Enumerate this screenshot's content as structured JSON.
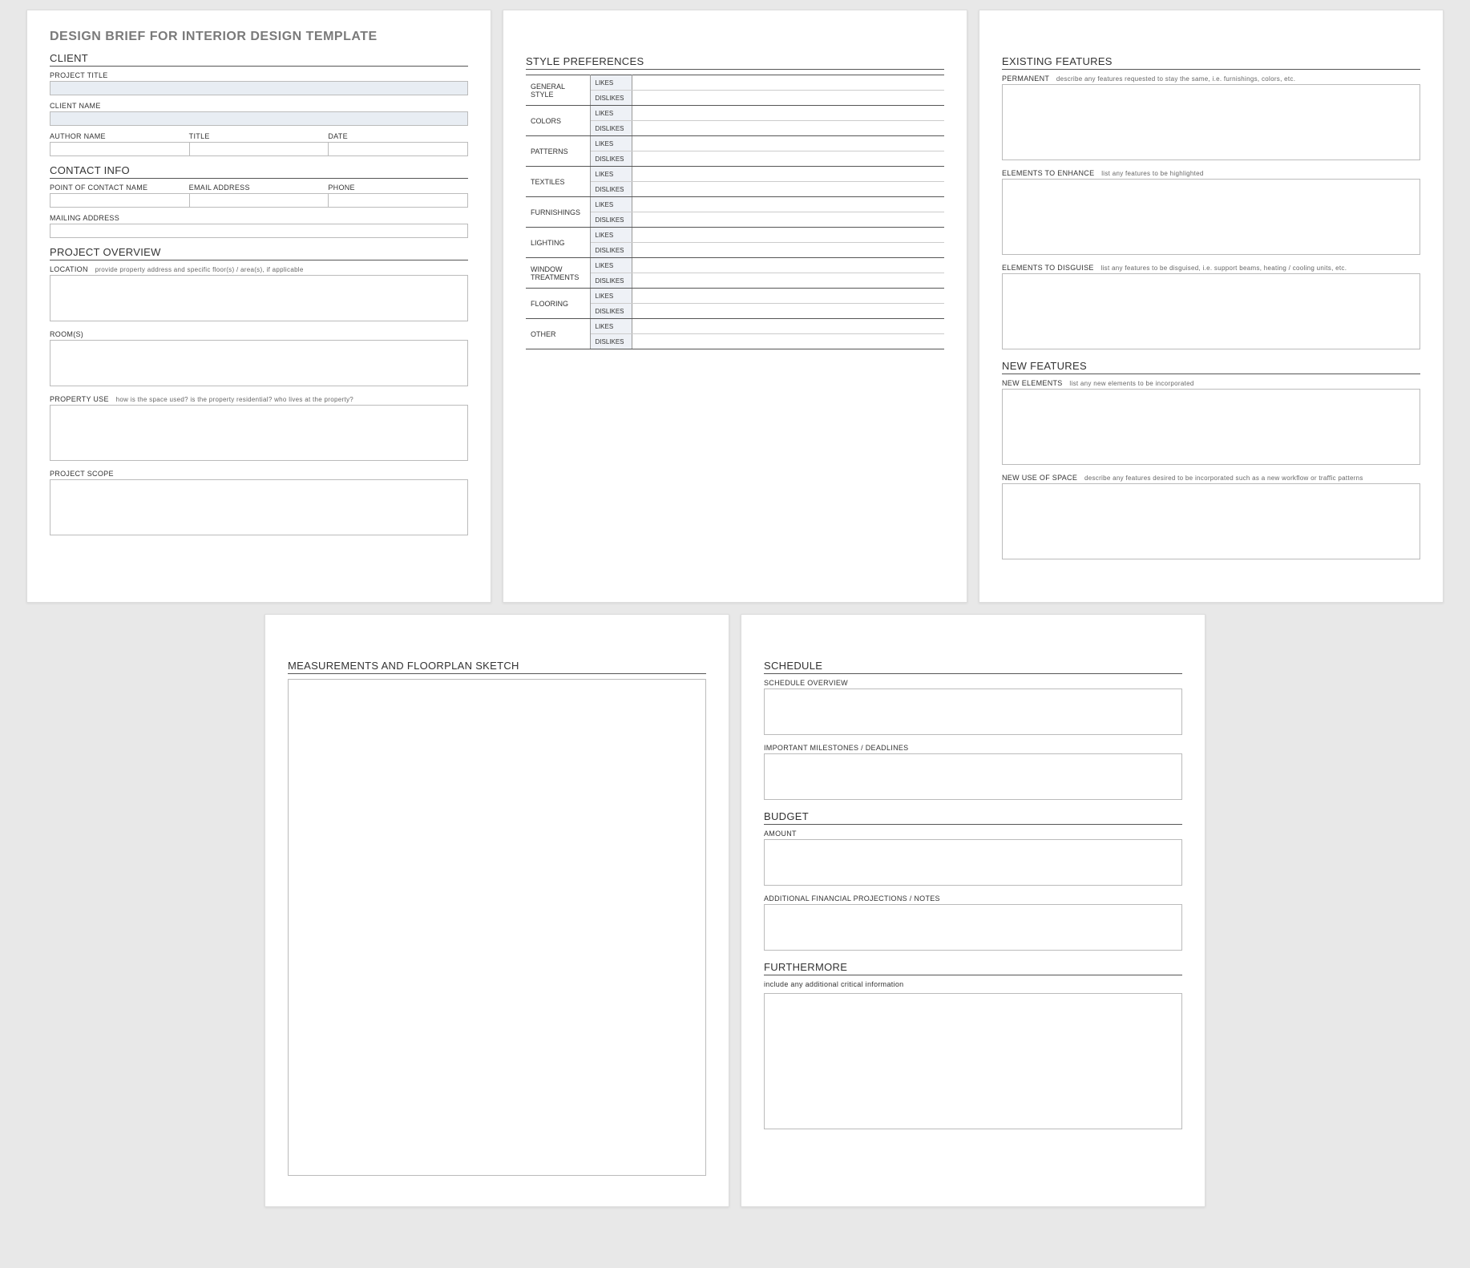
{
  "doc_title": "DESIGN BRIEF FOR INTERIOR DESIGN TEMPLATE",
  "sections": {
    "client": "CLIENT",
    "contact_info": "CONTACT INFO",
    "project_overview": "PROJECT OVERVIEW",
    "style_prefs": "STYLE PREFERENCES",
    "existing_features": "EXISTING FEATURES",
    "new_features": "NEW FEATURES",
    "measurements": "MEASUREMENTS AND FLOORPLAN SKETCH",
    "schedule": "SCHEDULE",
    "budget": "BUDGET",
    "furthermore": "FURTHERMORE"
  },
  "client": {
    "project_title_label": "PROJECT TITLE",
    "project_title": "",
    "client_name_label": "CLIENT NAME",
    "client_name": "",
    "author_name_label": "AUTHOR NAME",
    "author_name": "",
    "title_label": "TITLE",
    "title": "",
    "date_label": "DATE",
    "date": ""
  },
  "contact": {
    "poc_label": "POINT OF CONTACT NAME",
    "poc": "",
    "email_label": "EMAIL ADDRESS",
    "email": "",
    "phone_label": "PHONE",
    "phone": "",
    "mailing_label": "MAILING ADDRESS",
    "mailing": ""
  },
  "overview": {
    "location_label": "LOCATION",
    "location_hint": "provide property address and specific floor(s) / area(s), if applicable",
    "location": "",
    "rooms_label": "ROOM(S)",
    "rooms": "",
    "property_use_label": "PROPERTY USE",
    "property_use_hint": "how is the space used?  is the property residential? who lives at the property?",
    "property_use": "",
    "scope_label": "PROJECT SCOPE",
    "scope": ""
  },
  "prefs": {
    "likes": "LIKES",
    "dislikes": "DISLIKES",
    "categories": [
      "GENERAL STYLE",
      "COLORS",
      "PATTERNS",
      "TEXTILES",
      "FURNISHINGS",
      "LIGHTING",
      "WINDOW TREATMENTS",
      "FLOORING",
      "OTHER"
    ]
  },
  "existing": {
    "permanent_label": "PERMANENT",
    "permanent_hint": "describe any features requested to stay the same, i.e. furnishings, colors, etc.",
    "permanent": "",
    "enhance_label": "ELEMENTS TO ENHANCE",
    "enhance_hint": "list any features to be highlighted",
    "enhance": "",
    "disguise_label": "ELEMENTS TO DISGUISE",
    "disguise_hint": "list any features to be disguised, i.e. support beams, heating / cooling units, etc.",
    "disguise": ""
  },
  "newfeat": {
    "new_elements_label": "NEW ELEMENTS",
    "new_elements_hint": "list any new elements to be incorporated",
    "new_elements": "",
    "new_use_label": "NEW USE OF SPACE",
    "new_use_hint": "describe any features desired to be incorporated such as a new workflow or traffic patterns",
    "new_use": ""
  },
  "schedule": {
    "overview_label": "SCHEDULE OVERVIEW",
    "overview": "",
    "milestones_label": "IMPORTANT MILESTONES / DEADLINES",
    "milestones": ""
  },
  "budget": {
    "amount_label": "AMOUNT",
    "amount": "",
    "notes_label": "ADDITIONAL FINANCIAL PROJECTIONS / NOTES",
    "notes": ""
  },
  "furthermore": {
    "hint": "include any additional critical information",
    "text": ""
  }
}
